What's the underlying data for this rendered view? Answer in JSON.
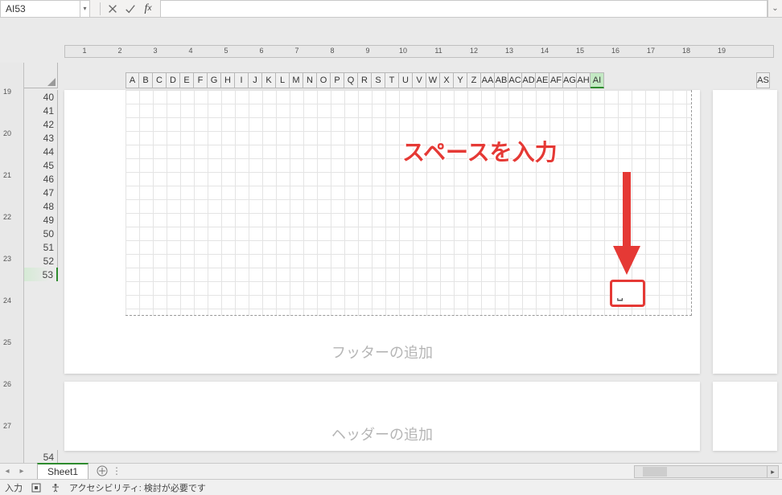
{
  "nameBox": {
    "value": "AI53"
  },
  "formulaBar": {
    "value": ""
  },
  "hruler": {
    "numbers": [
      1,
      2,
      3,
      4,
      5,
      6,
      7,
      8,
      9,
      10,
      11,
      12,
      13,
      14,
      15,
      16,
      17,
      18,
      19
    ]
  },
  "vruler": {
    "numbers": [
      19,
      20,
      21,
      22,
      23,
      24,
      25,
      26,
      27
    ]
  },
  "rows": [
    40,
    41,
    42,
    43,
    44,
    45,
    46,
    47,
    48,
    49,
    50,
    51,
    52,
    53
  ],
  "rows2": [
    54
  ],
  "activeRow": 53,
  "cols": [
    "A",
    "B",
    "C",
    "D",
    "E",
    "F",
    "G",
    "H",
    "I",
    "J",
    "K",
    "L",
    "M",
    "N",
    "O",
    "P",
    "Q",
    "R",
    "S",
    "T",
    "U",
    "V",
    "W",
    "X",
    "Y",
    "Z",
    "AA",
    "AB",
    "AC",
    "AD",
    "AE",
    "AF",
    "AG",
    "AH",
    "AI"
  ],
  "activeCol": "AI",
  "cols2Start": "AS",
  "footer": {
    "label": "フッターの追加"
  },
  "header": {
    "label": "ヘッダーの追加"
  },
  "annotation": {
    "text": "スペースを入力"
  },
  "tabs": {
    "active": "Sheet1"
  },
  "status": {
    "mode": "入力",
    "accessibility": "アクセシビリティ: 検討が必要です"
  }
}
